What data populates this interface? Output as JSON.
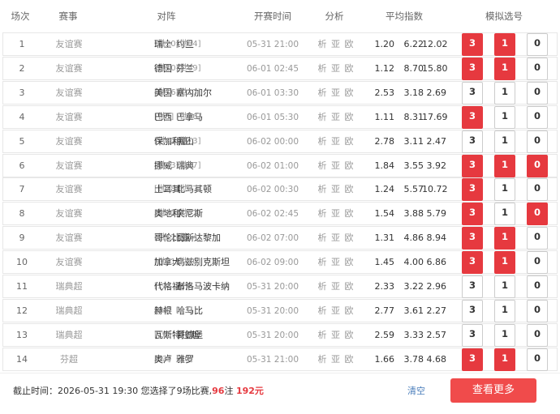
{
  "header": {
    "num": "场次",
    "league": "赛事",
    "match": "对阵",
    "time": "开赛时间",
    "analysis": "分析",
    "odds": "平均指数",
    "picks": "模拟选号"
  },
  "colors": {
    "accent": "#e6393f",
    "link": "#4a7ebb"
  },
  "vs_text": "VS",
  "analysis_text": "析 亚 欧",
  "pick_labels": [
    "3",
    "1",
    "0"
  ],
  "rows": [
    {
      "num": "1",
      "league": "友谊赛",
      "home_rank": "[世20]",
      "home": "瑞士",
      "away": "约旦",
      "away_rank": "[世64]",
      "time": "05-31 21:00",
      "o1": "1.20",
      "o2": "6.22",
      "o3": "12.02",
      "sel": [
        true,
        true,
        false
      ]
    },
    {
      "num": "2",
      "league": "友谊赛",
      "home_rank": "[世10]",
      "home": "德国",
      "away": "芬兰",
      "away_rank": "[世69]",
      "time": "06-01 02:45",
      "o1": "1.12",
      "o2": "8.70",
      "o3": "15.80",
      "sel": [
        true,
        true,
        false
      ]
    },
    {
      "num": "3",
      "league": "友谊赛",
      "home_rank": "[世16]",
      "home": "美国",
      "away": "塞内加尔",
      "away_rank": "[世17]",
      "time": "06-01 03:30",
      "o1": "2.53",
      "o2": "3.18",
      "o3": "2.69",
      "sel": [
        false,
        false,
        false
      ]
    },
    {
      "num": "4",
      "league": "友谊赛",
      "home_rank": "[世5]",
      "home": "巴西",
      "away": "巴拿马",
      "away_rank": "[世36]",
      "time": "06-01 05:30",
      "o1": "1.11",
      "o2": "8.31",
      "o3": "17.69",
      "sel": [
        true,
        false,
        false
      ]
    },
    {
      "num": "5",
      "league": "友谊赛",
      "home_rank": "[世82]",
      "home": "保加利亚",
      "away": "黑山",
      "away_rank": "[世73]",
      "time": "06-02 00:00",
      "o1": "2.78",
      "o2": "3.11",
      "o3": "2.47",
      "sel": [
        false,
        false,
        false
      ]
    },
    {
      "num": "6",
      "league": "友谊赛",
      "home_rank": "[世43]",
      "home": "挪威",
      "away": "瑞典",
      "away_rank": "[世27]",
      "time": "06-02 01:00",
      "o1": "1.84",
      "o2": "3.55",
      "o3": "3.92",
      "sel": [
        true,
        true,
        true
      ]
    },
    {
      "num": "7",
      "league": "友谊赛",
      "home_rank": "[世28]",
      "home": "土耳其",
      "away": "北马其顿",
      "away_rank": "[世67]",
      "time": "06-02 00:30",
      "o1": "1.24",
      "o2": "5.57",
      "o3": "10.72",
      "sel": [
        true,
        false,
        false
      ]
    },
    {
      "num": "8",
      "league": "友谊赛",
      "home_rank": "[世22]",
      "home": "奥地利",
      "away": "突尼斯",
      "away_rank": "[世52]",
      "time": "06-02 02:45",
      "o1": "1.54",
      "o2": "3.88",
      "o3": "5.79",
      "sel": [
        true,
        false,
        true
      ]
    },
    {
      "num": "9",
      "league": "友谊赛",
      "home_rank": "[世12]",
      "home": "哥伦比亚",
      "away": "哥斯达黎加",
      "away_rank": "[世54]",
      "time": "06-02 07:00",
      "o1": "1.31",
      "o2": "4.86",
      "o3": "8.94",
      "sel": [
        true,
        true,
        false
      ]
    },
    {
      "num": "10",
      "league": "友谊赛",
      "home_rank": "[世31]",
      "home": "加拿大",
      "away": "乌兹别克斯坦",
      "away_rank": "[世50]",
      "time": "06-02 09:00",
      "o1": "1.45",
      "o2": "4.00",
      "o3": "6.86",
      "sel": [
        true,
        true,
        false
      ]
    },
    {
      "num": "11",
      "league": "瑞典超",
      "home_rank": "[13]",
      "home": "代格福什",
      "away": "布洛马波卡纳",
      "away_rank": "[07]",
      "time": "05-31 20:00",
      "o1": "2.33",
      "o2": "3.22",
      "o3": "2.96",
      "sel": [
        false,
        false,
        false
      ]
    },
    {
      "num": "12",
      "league": "瑞典超",
      "home_rank": "[04]",
      "home": "赫根",
      "away": "哈马比",
      "away_rank": "[03]",
      "time": "05-31 20:00",
      "o1": "2.77",
      "o2": "3.61",
      "o3": "2.27",
      "sel": [
        false,
        false,
        false
      ]
    },
    {
      "num": "13",
      "league": "瑞典超",
      "home_rank": "[10]",
      "home": "瓦斯特拉斯",
      "away": "哥德堡",
      "away_rank": "[14]",
      "time": "05-31 20:00",
      "o1": "2.59",
      "o2": "3.33",
      "o3": "2.57",
      "sel": [
        false,
        false,
        false
      ]
    },
    {
      "num": "14",
      "league": "芬超",
      "home_rank": "[03]",
      "home": "奥卢",
      "away": "雅罗",
      "away_rank": "[10]",
      "time": "05-31 21:00",
      "o1": "1.66",
      "o2": "3.78",
      "o3": "4.68",
      "sel": [
        true,
        true,
        false
      ]
    }
  ],
  "footer": {
    "deadline_prefix": "截止时间：",
    "deadline": "2026-05-31 19:30",
    "selected_text": " 您选择了9场比赛,",
    "bets": "96",
    "bets_unit": "注 ",
    "amount": "192元",
    "clear_label": "清空",
    "more_label": "查看更多"
  }
}
